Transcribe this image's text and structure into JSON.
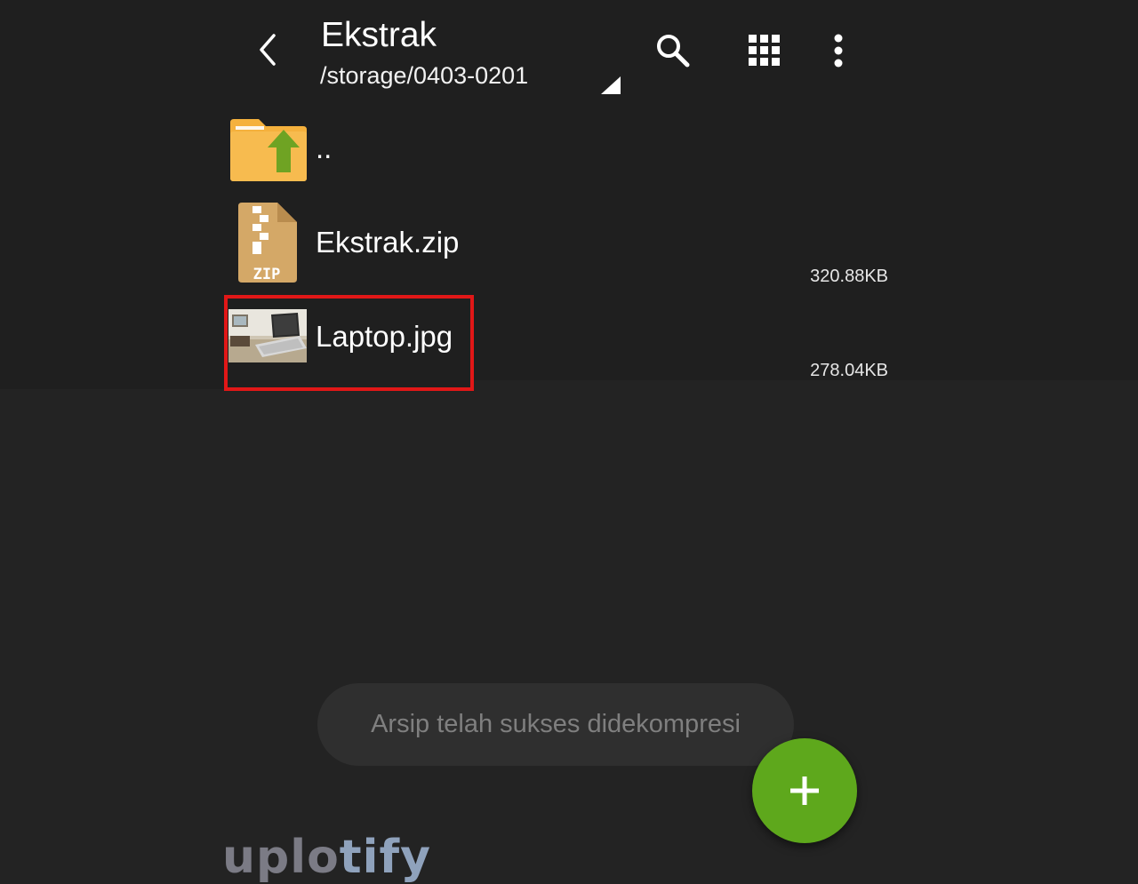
{
  "header": {
    "title": "Ekstrak",
    "path": "/storage/0403-0201",
    "icons": {
      "back": "back-arrow-icon",
      "search": "search-icon",
      "grid": "grid-view-icon",
      "more": "more-vert-icon",
      "dropdown": "dropdown-triangle-icon"
    }
  },
  "files": [
    {
      "name": "..",
      "size": "",
      "icon": "folder-up-icon"
    },
    {
      "name": "Ekstrak.zip",
      "size": "320.88KB",
      "icon": "zip-file-icon",
      "icon_label": "ZIP"
    },
    {
      "name": "Laptop.jpg",
      "size": "278.04KB",
      "icon": "image-thumbnail-icon",
      "highlighted": true
    }
  ],
  "toast": {
    "text": "Arsip telah sukses didekompresi"
  },
  "fab": {
    "icon": "plus-icon"
  },
  "watermark": {
    "part1": "uplo",
    "part2": "tify"
  },
  "colors": {
    "background": "#232323",
    "list_background": "#1f1f1f",
    "highlight": "#e11717",
    "fab": "#5ea81c",
    "folder": "#f5b13d",
    "folder_arrow": "#6fa323",
    "zip": "#d4a867"
  }
}
